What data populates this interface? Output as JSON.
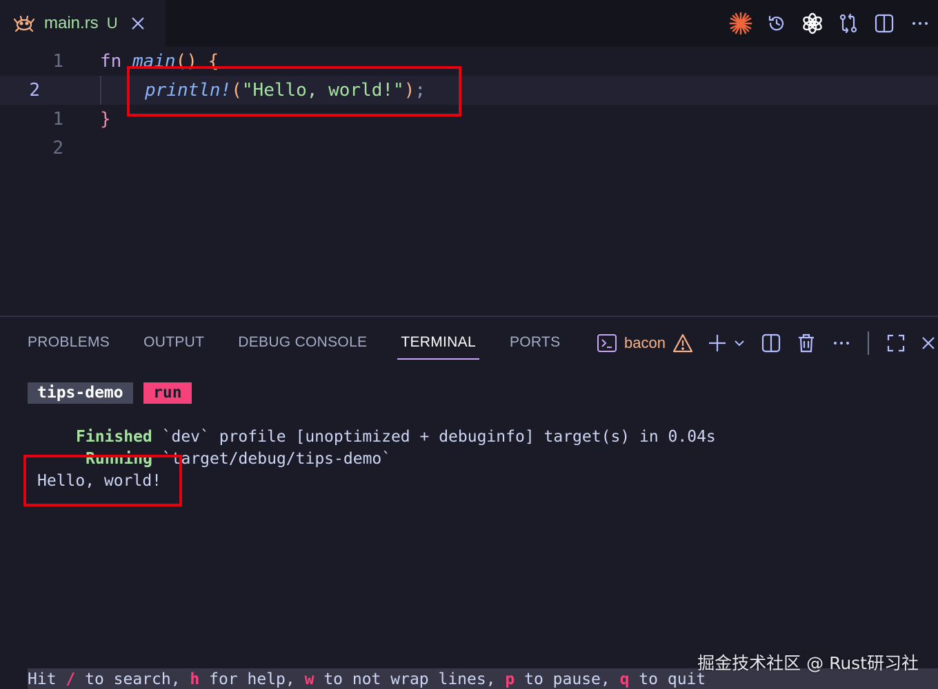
{
  "tab": {
    "icon": "ferris-crab-icon",
    "filename": "main.rs",
    "status": "U"
  },
  "toolbar_icons": [
    "spark-icon",
    "history-icon",
    "openai-icon",
    "compare-changes-icon",
    "split-editor-icon",
    "more-actions-icon"
  ],
  "editor": {
    "lines": [
      {
        "number": "1",
        "tokens": {
          "kw": "fn",
          "fn": "main",
          "parens": "()",
          "brace": "{"
        }
      },
      {
        "number": "2",
        "tokens": {
          "macro": "println!",
          "open": "(",
          "string": "\"Hello, world!\"",
          "close": ")",
          "semi": ";"
        }
      },
      {
        "number": "1",
        "tokens": {
          "brace": "}"
        }
      },
      {
        "number": "2"
      }
    ]
  },
  "panel": {
    "tabs": [
      "PROBLEMS",
      "OUTPUT",
      "DEBUG CONSOLE",
      "TERMINAL",
      "PORTS"
    ],
    "active_tab": "TERMINAL",
    "terminal_name": "bacon"
  },
  "terminal": {
    "badge_project": "tips-demo",
    "badge_job": "run",
    "finished_label": "Finished",
    "finished_text": " `dev` profile [unoptimized + debuginfo] target(s) in 0.04s",
    "running_label": "Running",
    "running_text": " `target/debug/tips-demo`",
    "output": "Hello, world!",
    "status": {
      "hit": "Hit ",
      "k1": "/",
      "t1": " to search, ",
      "k2": "h",
      "t2": " for help, ",
      "k3": "w",
      "t3": " to not wrap lines, ",
      "k4": "p",
      "t4": " to pause, ",
      "k5": "q",
      "t5": " to quit"
    }
  },
  "watermark": "掘金技术社区 @ Rust研习社",
  "colors": {
    "highlight_box": "#e8000d",
    "accent": "#cba6f7",
    "keyword_pink": "#f5427b"
  }
}
